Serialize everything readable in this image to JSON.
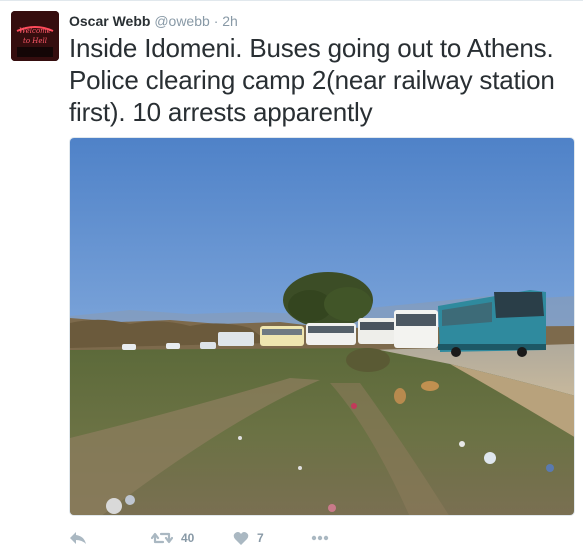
{
  "tweet": {
    "display_name": "Oscar Webb",
    "handle": "@owebb",
    "separator": "·",
    "time": "2h",
    "text": "Inside Idomeni. Buses going out to Athens. Police clearing camp 2(near railway station first). 10 arrests apparently"
  },
  "avatar": {
    "sign_text": "Welcome to Hell"
  },
  "actions": {
    "retweet_count": "40",
    "like_count": "7"
  },
  "colors": {
    "text": "#292f33",
    "muted": "#8899a6",
    "icon": "#aab8c2"
  },
  "icons": [
    "reply-icon",
    "retweet-icon",
    "heart-icon",
    "more-icon"
  ]
}
